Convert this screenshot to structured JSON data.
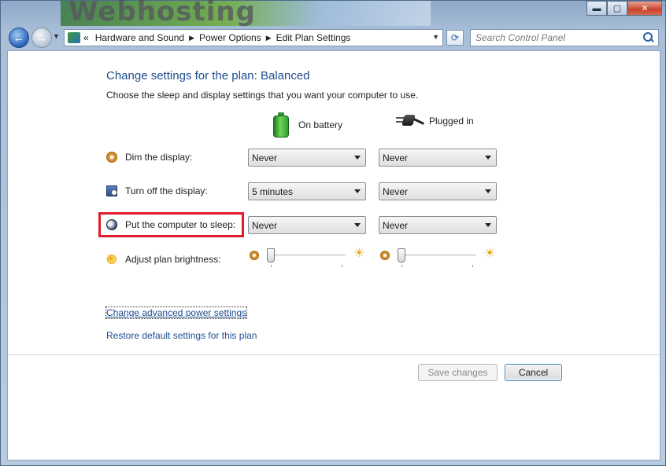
{
  "titlebar": {
    "banner_text": "Webhosting",
    "min_label": "▬",
    "max_label": "▢",
    "close_label": "✕"
  },
  "nav": {
    "back_label": "←",
    "forward_label": "→",
    "history_label": "▼",
    "overflow_label": "«",
    "breadcrumbs": [
      "Hardware and Sound",
      "Power Options",
      "Edit Plan Settings"
    ],
    "crumb_separator": "▶",
    "dropdown_label": "▼",
    "refresh_label": "⟳",
    "search_placeholder": "Search Control Panel"
  },
  "page": {
    "title": "Change settings for the plan: Balanced",
    "subtitle": "Choose the sleep and display settings that you want your computer to use."
  },
  "columns": {
    "battery": "On battery",
    "plugged": "Plugged in"
  },
  "settings": [
    {
      "label": "Dim the display:",
      "battery": "Never",
      "plugged": "Never"
    },
    {
      "label": "Turn off the display:",
      "battery": "5 minutes",
      "plugged": "Never"
    },
    {
      "label": "Put the computer to sleep:",
      "battery": "Never",
      "plugged": "Never"
    },
    {
      "label": "Adjust plan brightness:"
    }
  ],
  "brightness": {
    "battery_level": 0,
    "plugged_level": 0,
    "bright_icon": "☀"
  },
  "links": {
    "advanced": "Change advanced power settings",
    "restore": "Restore default settings for this plan"
  },
  "buttons": {
    "save": "Save changes",
    "cancel": "Cancel"
  }
}
